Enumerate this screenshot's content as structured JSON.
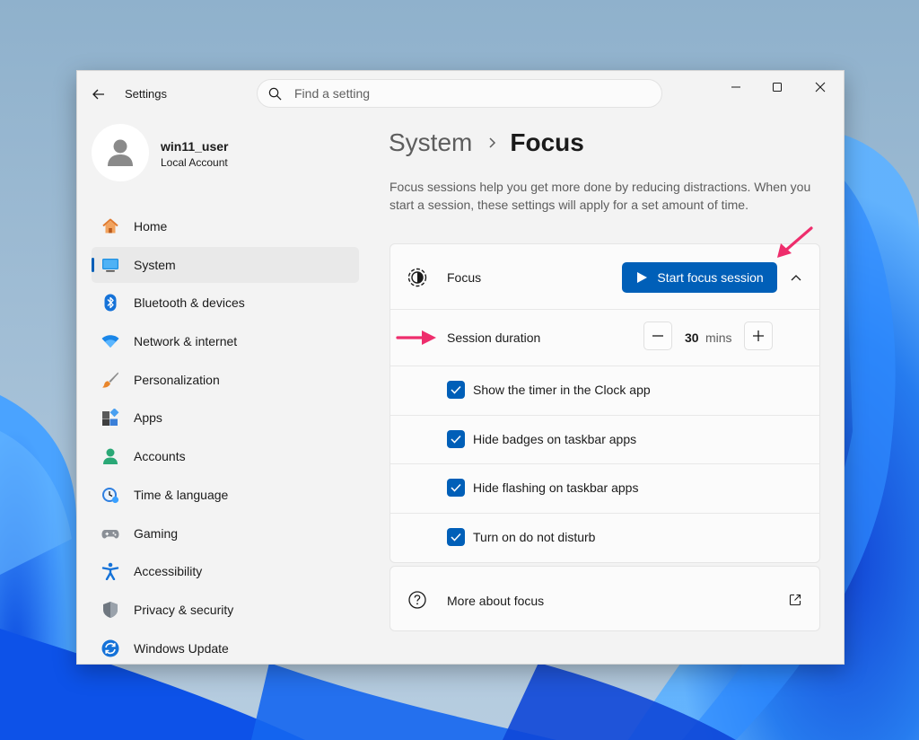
{
  "colors": {
    "accent": "#005fb8",
    "annotation_arrow": "#ee2d6c"
  },
  "window": {
    "title": "Settings",
    "search_placeholder": "Find a setting",
    "controls": [
      "minimize-icon",
      "maximize-icon",
      "close-icon"
    ]
  },
  "profile": {
    "name": "win11_user",
    "account_type": "Local Account"
  },
  "sidebar": {
    "items": [
      {
        "label": "Home",
        "icon": "home-icon"
      },
      {
        "label": "System",
        "icon": "system-icon",
        "selected": true
      },
      {
        "label": "Bluetooth & devices",
        "icon": "bluetooth-icon"
      },
      {
        "label": "Network & internet",
        "icon": "wifi-icon"
      },
      {
        "label": "Personalization",
        "icon": "brush-icon"
      },
      {
        "label": "Apps",
        "icon": "apps-icon"
      },
      {
        "label": "Accounts",
        "icon": "accounts-icon"
      },
      {
        "label": "Time & language",
        "icon": "clock-globe-icon"
      },
      {
        "label": "Gaming",
        "icon": "gamepad-icon"
      },
      {
        "label": "Accessibility",
        "icon": "accessibility-icon"
      },
      {
        "label": "Privacy & security",
        "icon": "shield-icon"
      },
      {
        "label": "Windows Update",
        "icon": "update-icon"
      }
    ]
  },
  "main": {
    "breadcrumb_parent": "System",
    "breadcrumb_current": "Focus",
    "description": "Focus sessions help you get more done by reducing distractions. When you start a session, these settings will apply for a set amount of time.",
    "focus_card": {
      "title": "Focus",
      "start_button": "Start focus session",
      "session_duration_label": "Session duration",
      "duration_value": "30",
      "duration_unit": "mins",
      "options": [
        {
          "label": "Show the timer in the Clock app",
          "checked": true
        },
        {
          "label": "Hide badges on taskbar apps",
          "checked": true
        },
        {
          "label": "Hide flashing on taskbar apps",
          "checked": true
        },
        {
          "label": "Turn on do not disturb",
          "checked": true
        }
      ]
    },
    "more_card": {
      "label": "More about focus"
    }
  }
}
